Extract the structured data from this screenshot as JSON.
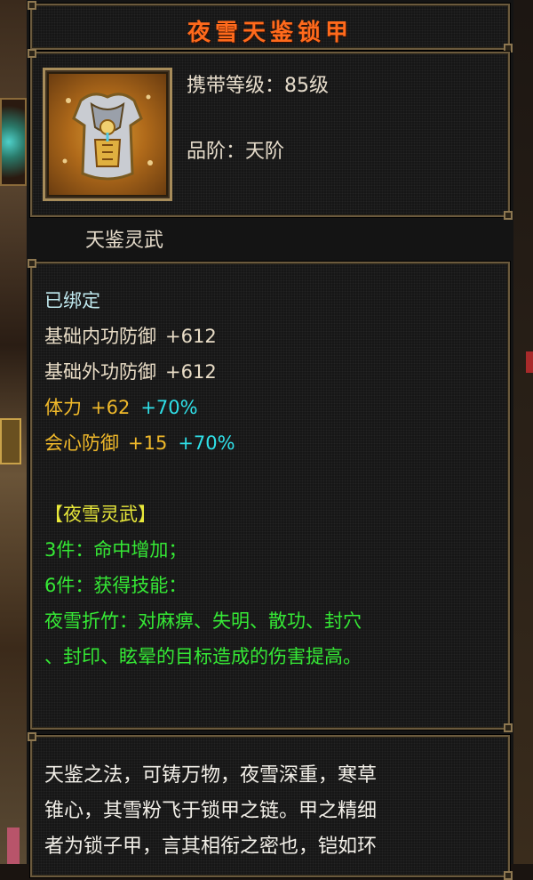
{
  "item": {
    "name": "夜雪天鉴锁甲",
    "level_label": "携带等级：",
    "level_value": "85级",
    "grade_label": "品阶：",
    "grade_value": "天阶",
    "set_name": "天鉴灵武",
    "icon": "armor-chestplate-icon"
  },
  "stats": {
    "bound": "已绑定",
    "base": [
      {
        "label": "基础内功防御",
        "value": "+612"
      },
      {
        "label": "基础外功防御",
        "value": "+612"
      }
    ],
    "bonus": [
      {
        "label": "体力",
        "value": "+62",
        "percent": "+70%"
      },
      {
        "label": "会心防御",
        "value": "+15",
        "percent": "+70%"
      }
    ]
  },
  "set_bonus": {
    "title": "【夜雪灵武】",
    "piece3": "3件：命中增加；",
    "piece6": "6件：获得技能：",
    "skill_line1": "夜雪折竹：对麻痹、失明、散功、封穴",
    "skill_line2": "、封印、眩晕的目标造成的伤害提高。"
  },
  "description": {
    "line1": "天鉴之法，可铸万物，夜雪深重，寒草",
    "line2": "锥心，其雪粉飞于锁甲之链。甲之精细",
    "line3": "者为锁子甲，言其相衔之密也，铠如环"
  },
  "colors": {
    "title": "#ff6a1c",
    "gold_stat": "#f0b92a",
    "percent": "#2fe0e8",
    "set_effect": "#35e835",
    "set_title": "#e8e83a"
  }
}
